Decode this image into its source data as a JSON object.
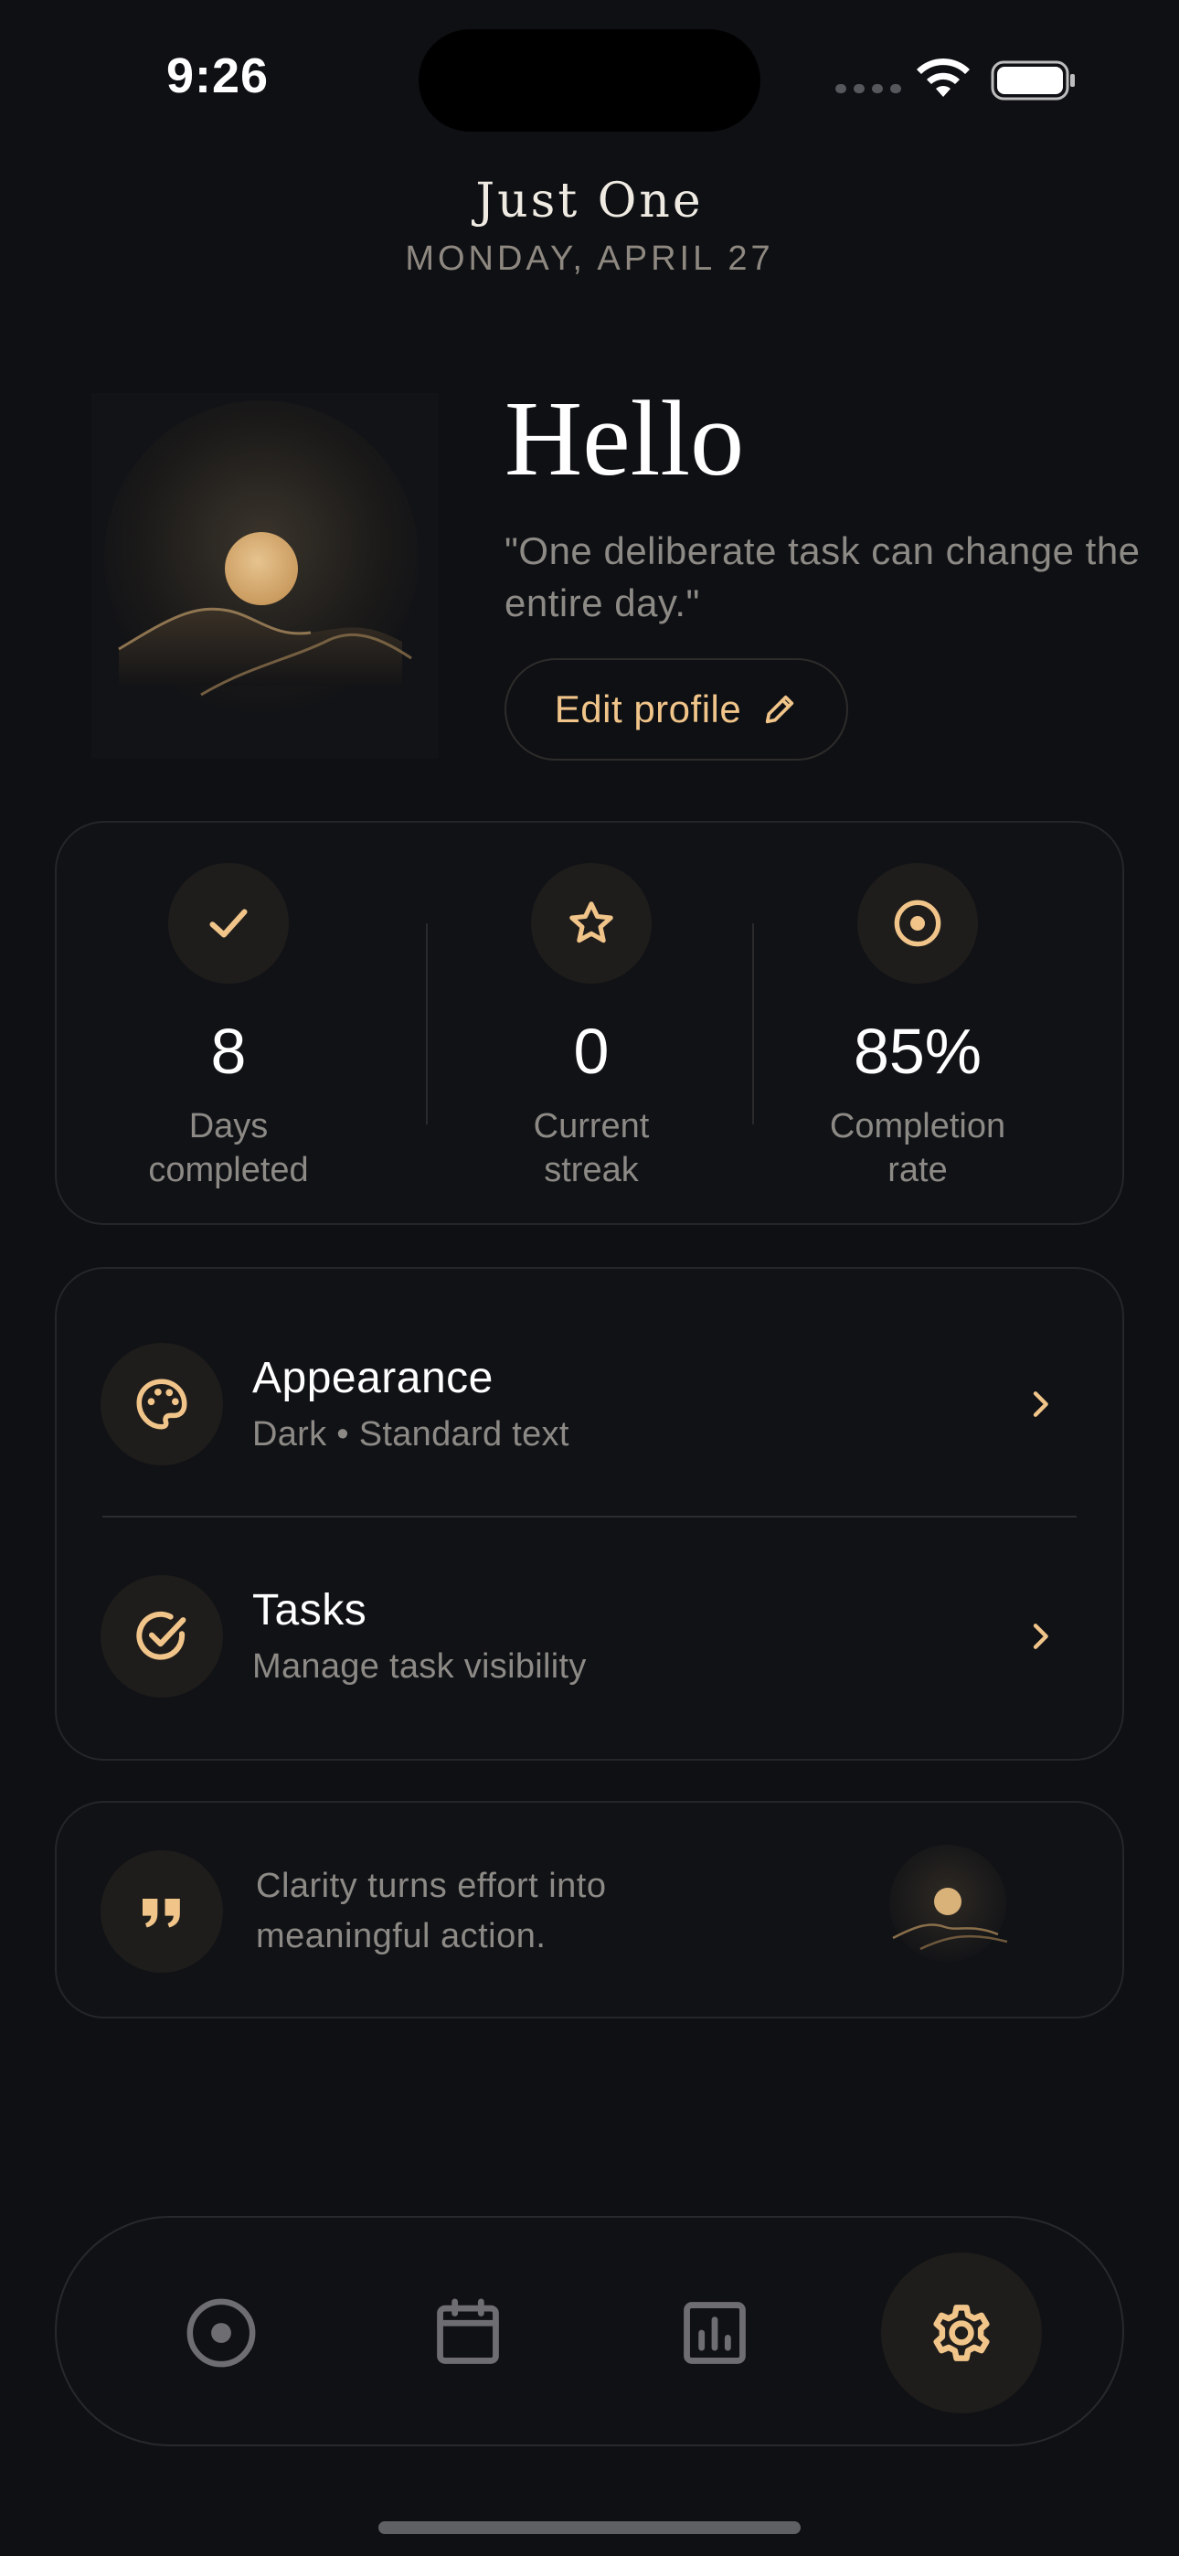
{
  "status_bar": {
    "time": "9:26"
  },
  "header": {
    "app_title": "Just One",
    "date": "MONDAY, APRIL 27"
  },
  "profile": {
    "greeting": "Hello",
    "quote": "\"One deliberate task can change the entire day.\"",
    "edit_label": "Edit profile"
  },
  "stats": [
    {
      "value": "8",
      "label_line1": "Days",
      "label_line2": "completed",
      "icon": "check-icon"
    },
    {
      "value": "0",
      "label_line1": "Current",
      "label_line2": "streak",
      "icon": "star-icon"
    },
    {
      "value": "85%",
      "label_line1": "Completion",
      "label_line2": "rate",
      "icon": "target-icon"
    }
  ],
  "settings": [
    {
      "title": "Appearance",
      "subtitle": "Dark • Standard text",
      "icon": "palette-icon"
    },
    {
      "title": "Tasks",
      "subtitle": "Manage task visibility",
      "icon": "check-circle-icon"
    }
  ],
  "quote_card": {
    "text": "Clarity turns effort into meaningful action.",
    "icon": "quote-icon"
  },
  "tabs": [
    {
      "name": "today",
      "icon": "target-icon",
      "active": false
    },
    {
      "name": "calendar",
      "icon": "calendar-icon",
      "active": false
    },
    {
      "name": "stats",
      "icon": "bar-chart-icon",
      "active": false
    },
    {
      "name": "settings",
      "icon": "gear-icon",
      "active": true
    }
  ],
  "colors": {
    "background": "#0e1014",
    "accent": "#f1c58a",
    "muted_text": "#8d8a86",
    "card_border": "#25262a"
  }
}
